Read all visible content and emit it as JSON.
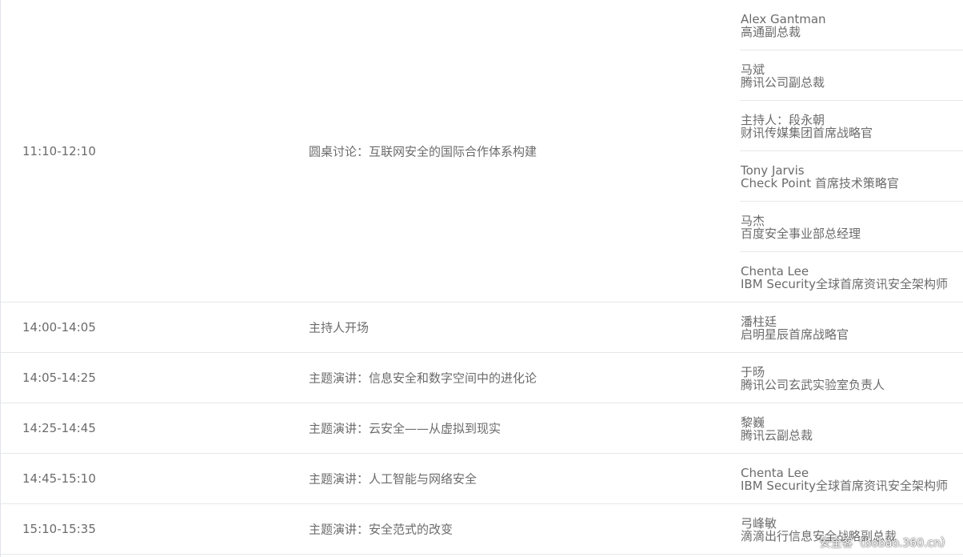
{
  "rows": [
    {
      "time": "11:10-12:10",
      "topic": "圆桌讨论：互联网安全的国际合作体系构建",
      "speakers": [
        {
          "name": "Alex Gantman",
          "title": "高通副总裁"
        },
        {
          "name": "马斌",
          "title": "腾讯公司副总裁"
        },
        {
          "name": "主持人：段永朝",
          "title": "财讯传媒集团首席战略官"
        },
        {
          "name": "Tony Jarvis",
          "title": "Check Point 首席技术策略官"
        },
        {
          "name": "马杰",
          "title": "百度安全事业部总经理"
        },
        {
          "name": "Chenta Lee",
          "title": "IBM Security全球首席资讯安全架构师"
        }
      ]
    },
    {
      "time": "14:00-14:05",
      "topic": "主持人开场",
      "speakers": [
        {
          "name": "潘柱廷",
          "title": "启明星辰首席战略官"
        }
      ]
    },
    {
      "time": "14:05-14:25",
      "topic": "主题演讲：信息安全和数字空间中的进化论",
      "speakers": [
        {
          "name": "于旸",
          "title": "腾讯公司玄武实验室负责人"
        }
      ]
    },
    {
      "time": "14:25-14:45",
      "topic": "主题演讲：云安全——从虚拟到现实",
      "speakers": [
        {
          "name": "黎巍",
          "title": "腾讯云副总裁"
        }
      ]
    },
    {
      "time": "14:45-15:10",
      "topic": "主题演讲：人工智能与网络安全",
      "speakers": [
        {
          "name": "Chenta Lee",
          "title": "IBM Security全球首席资讯安全架构师"
        }
      ]
    },
    {
      "time": "15:10-15:35",
      "topic": "主题演讲：安全范式的改变",
      "speakers": [
        {
          "name": "弓峰敏",
          "title": "滴滴出行信息安全战略副总裁"
        }
      ]
    }
  ],
  "watermark": "安全客（bobao.360.cn）",
  "colors": {
    "text": "#6b6b6b",
    "divider": "#e6e8eb",
    "background": "#ffffff"
  }
}
